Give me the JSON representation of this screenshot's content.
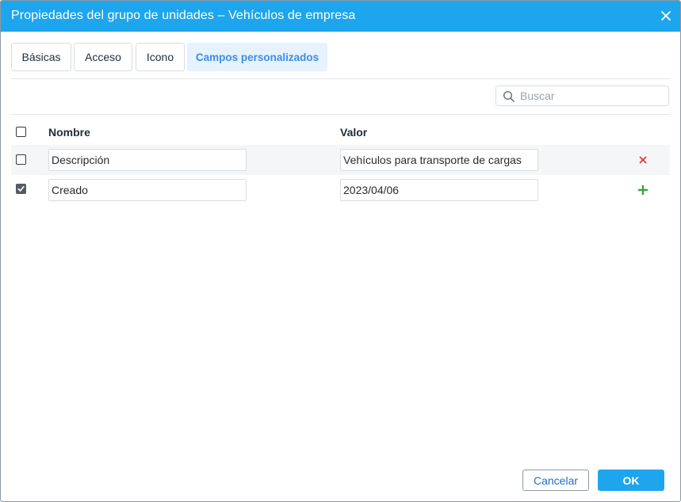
{
  "window": {
    "title": "Propiedades del grupo de unidades – Vehículos de empresa",
    "close_icon": "close-icon"
  },
  "tabs": [
    {
      "label": "Básicas",
      "active": false
    },
    {
      "label": "Acceso",
      "active": false
    },
    {
      "label": "Icono",
      "active": false
    },
    {
      "label": "Campos personalizados",
      "active": true
    }
  ],
  "search": {
    "placeholder": "Buscar",
    "value": "",
    "icon": "search-icon"
  },
  "table": {
    "headers": {
      "name": "Nombre",
      "value": "Valor"
    },
    "select_all_checked": false,
    "rows": [
      {
        "checked": false,
        "name": "Descripción",
        "value": "Vehículos para transporte de cargas",
        "action_icon": "delete-icon"
      },
      {
        "checked": true,
        "name": "Creado",
        "value": "2023/04/06",
        "action_icon": "add-icon"
      }
    ]
  },
  "footer": {
    "cancel_label": "Cancelar",
    "ok_label": "OK"
  },
  "colors": {
    "titlebar": "#1da5ed",
    "active_tab_bg": "#e6f2fd",
    "active_tab_text": "#3b8ee6",
    "delete_icon": "#e53935",
    "add_icon": "#43a047",
    "ok_button": "#1da5ed"
  }
}
